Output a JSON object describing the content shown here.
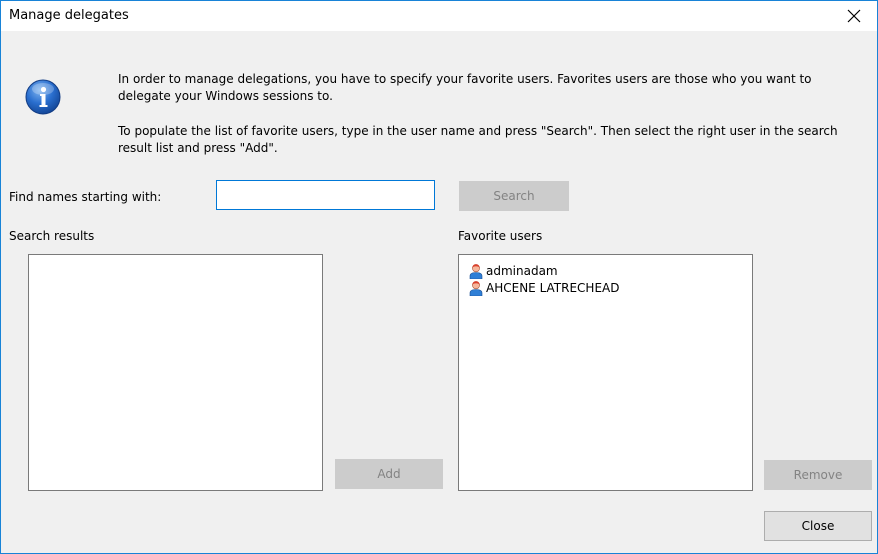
{
  "window": {
    "title": "Manage delegates"
  },
  "info": {
    "paragraph1": "In order to manage delegations, you have to specify your favorite users. Favorites users are those who you want to delegate your Windows sessions to.",
    "paragraph2": "To populate the list of favorite users, type in the user name and press \"Search\". Then select the right user in the search result list and press \"Add\"."
  },
  "search": {
    "label": "Find names starting with:",
    "value": "",
    "button_label": "Search"
  },
  "results": {
    "label": "Search results",
    "items": [],
    "add_label": "Add"
  },
  "favorites": {
    "label": "Favorite users",
    "items": [
      {
        "label": "adminadam",
        "icon": "user-icon"
      },
      {
        "label": "AHCENE LATRECHEAD",
        "icon": "user-icon"
      }
    ],
    "remove_label": "Remove"
  },
  "footer": {
    "close_label": "Close"
  },
  "icons": {
    "info": "info-icon",
    "close": "close-icon"
  }
}
